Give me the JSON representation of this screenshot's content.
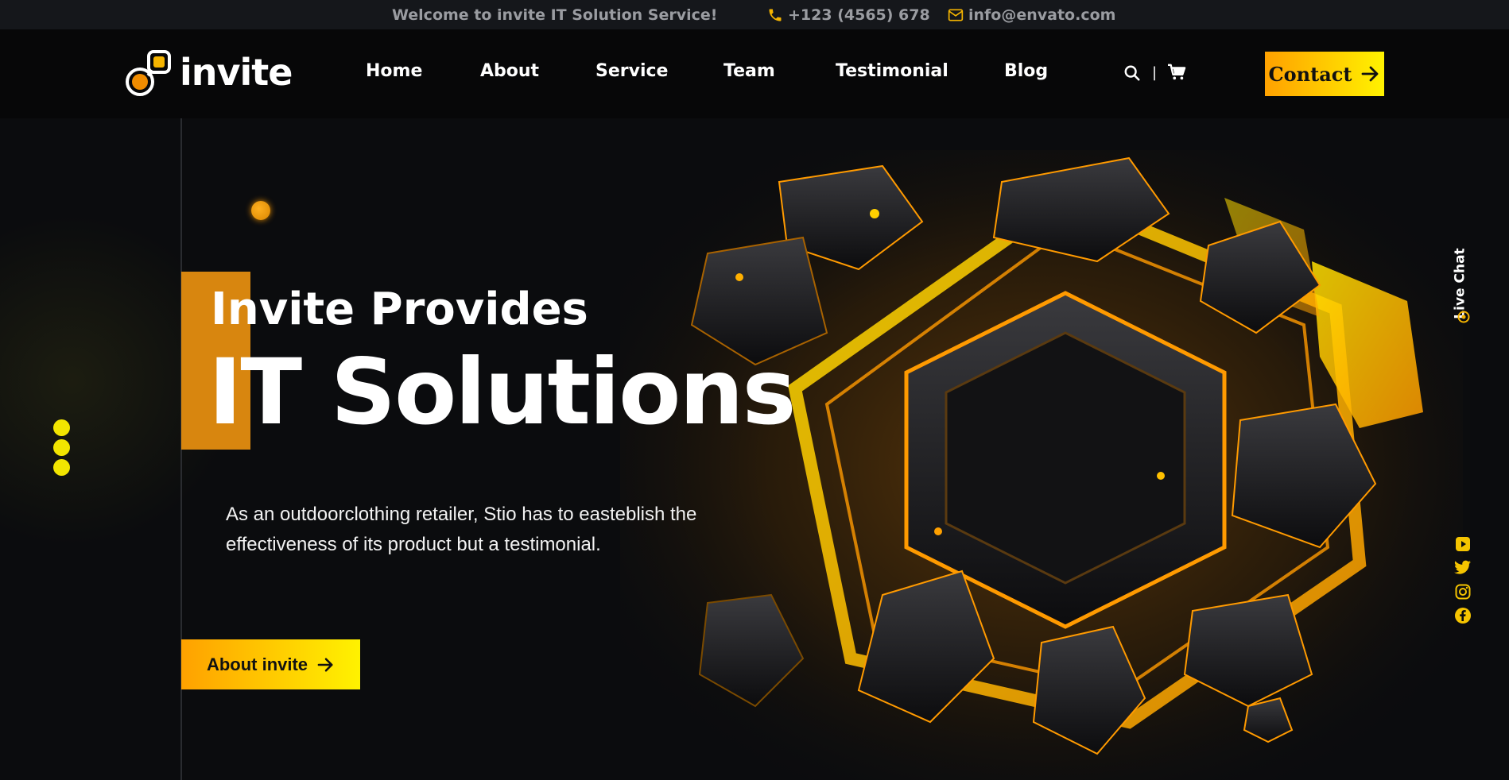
{
  "topbar": {
    "welcome": "Welcome to invite IT Solution Service!",
    "phone": "+123 (4565) 678",
    "email": "info@envato.com"
  },
  "brand": {
    "name": "invite"
  },
  "nav": {
    "items": [
      "Home",
      "About",
      "Service",
      "Team",
      "Testimonial",
      "Blog"
    ],
    "divider": "|",
    "contact_label": "Contact"
  },
  "hero": {
    "title_small": "Invite Provides",
    "title_big": "IT Solutions",
    "description": "As an outdoorclothing retailer, Stio has to easteblish the effectiveness of its product but a testimonial.",
    "button_label": "About invite"
  },
  "side": {
    "live_chat": "Live Chat",
    "socials": [
      "youtube-icon",
      "twitter-icon",
      "instagram-icon",
      "facebook-icon"
    ]
  },
  "colors": {
    "accent_start": "#ffa100",
    "accent_end": "#fff200",
    "orange_block": "#d8860f",
    "background": "#0b0c0e"
  }
}
